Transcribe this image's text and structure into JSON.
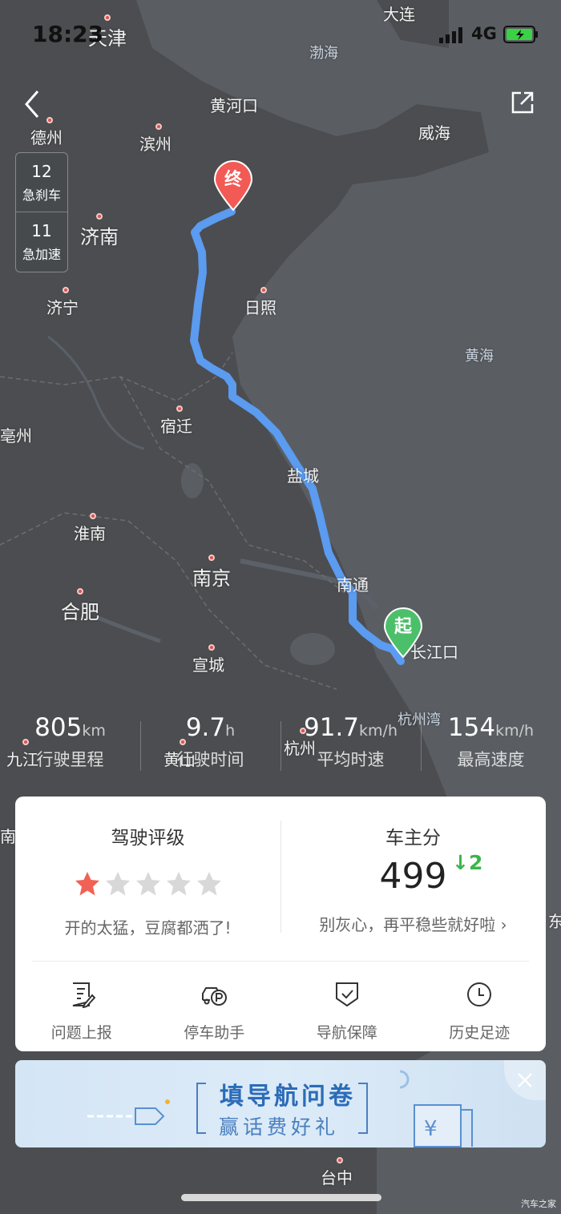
{
  "status_bar": {
    "time": "18:23",
    "network": "4G"
  },
  "map": {
    "cities": [
      {
        "name": "天津",
        "cls": "big"
      },
      {
        "name": "大连",
        "cls": ""
      },
      {
        "name": "渤海",
        "cls": "sea"
      },
      {
        "name": "黄河口",
        "cls": ""
      },
      {
        "name": "德州",
        "cls": ""
      },
      {
        "name": "滨州",
        "cls": ""
      },
      {
        "name": "威海",
        "cls": ""
      },
      {
        "name": "济南",
        "cls": "big"
      },
      {
        "name": "日照",
        "cls": ""
      },
      {
        "name": "济宁",
        "cls": ""
      },
      {
        "name": "黄海",
        "cls": "sea"
      },
      {
        "name": "亳州",
        "cls": ""
      },
      {
        "name": "宿迁",
        "cls": ""
      },
      {
        "name": "盐城",
        "cls": ""
      },
      {
        "name": "淮南",
        "cls": ""
      },
      {
        "name": "南京",
        "cls": "big"
      },
      {
        "name": "南通",
        "cls": ""
      },
      {
        "name": "合肥",
        "cls": "big"
      },
      {
        "name": "长江口",
        "cls": ""
      },
      {
        "name": "宣城",
        "cls": ""
      },
      {
        "name": "杭州湾",
        "cls": "sea"
      },
      {
        "name": "九江",
        "cls": ""
      },
      {
        "name": "黄山",
        "cls": ""
      },
      {
        "name": "杭州",
        "cls": ""
      },
      {
        "name": "台中",
        "cls": ""
      },
      {
        "name": "南",
        "cls": ""
      },
      {
        "name": "东",
        "cls": ""
      }
    ],
    "end_marker": "终",
    "start_marker": "起",
    "route_color": "#5b9bf0"
  },
  "events": {
    "hard_brake": {
      "count": "12",
      "label": "急刹车"
    },
    "hard_accel": {
      "count": "11",
      "label": "急加速"
    }
  },
  "stats": [
    {
      "value": "805",
      "unit": "km",
      "label": "行驶里程"
    },
    {
      "value": "9.7",
      "unit": "h",
      "label": "行驶时间"
    },
    {
      "value": "91.7",
      "unit": "km/h",
      "label": "平均时速"
    },
    {
      "value": "154",
      "unit": "km/h",
      "label": "最高速度"
    }
  ],
  "rating": {
    "title": "驾驶评级",
    "stars_filled": 1,
    "stars_total": 5,
    "comment": "开的太猛，豆腐都洒了!"
  },
  "owner_score": {
    "title": "车主分",
    "score": "499",
    "delta": "↓2",
    "tip": "别灰心，再平稳些就好啦 ›"
  },
  "tools": [
    {
      "label": "问题上报",
      "icon": "report-icon"
    },
    {
      "label": "停车助手",
      "icon": "parking-icon"
    },
    {
      "label": "导航保障",
      "icon": "shield-icon"
    },
    {
      "label": "历史足迹",
      "icon": "clock-icon"
    }
  ],
  "banner": {
    "line1": "填导航问卷",
    "line2": "赢话费好礼"
  },
  "watermark": "汽车之家",
  "colors": {
    "accent_red": "#f26155",
    "accent_green": "#3bb54a",
    "banner_blue": "#2b6cb8"
  }
}
